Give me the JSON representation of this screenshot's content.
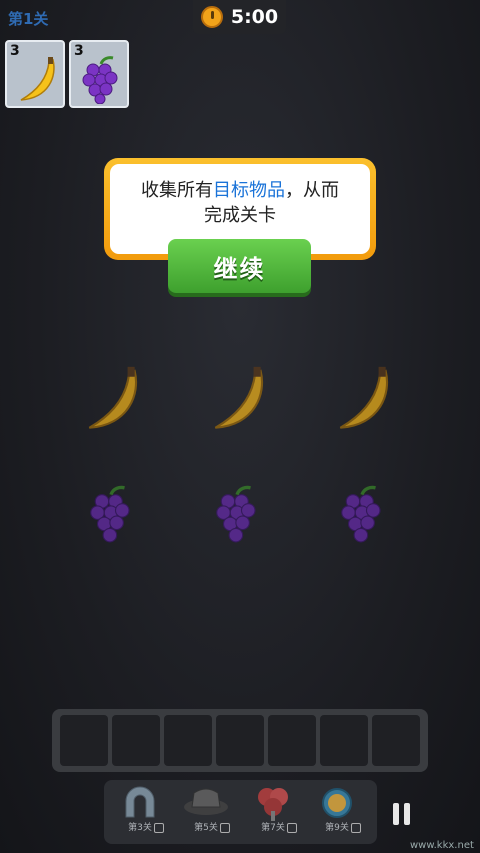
{
  "level": "第1关",
  "timer": "5:00",
  "targets": [
    {
      "count": "3",
      "item": "banana-icon"
    },
    {
      "count": "3",
      "item": "grapes-icon"
    }
  ],
  "dialog": {
    "line1_prefix": "收集所有",
    "line1_highlight": "目标物品",
    "line1_suffix": "，从而",
    "line2": "完成关卡",
    "button": "继续"
  },
  "tools": [
    {
      "label": "第3关"
    },
    {
      "label": "第5关"
    },
    {
      "label": "第7关"
    },
    {
      "label": "第9关"
    }
  ],
  "watermark": "www.kkx.net",
  "colors": {
    "highlight": "#1a73d8",
    "button": "#4fb83a",
    "dialog_border": "#f5a623"
  }
}
